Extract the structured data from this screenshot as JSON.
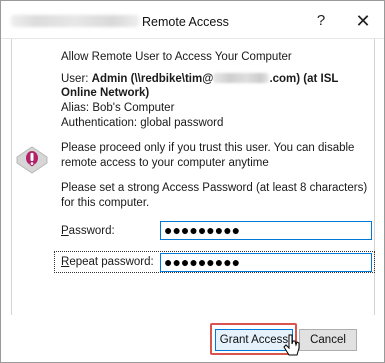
{
  "window": {
    "title": "Remote Access",
    "help_label": "?",
    "close_label": "✕"
  },
  "content": {
    "prompt": "Allow Remote User to Access Your Computer",
    "user_prefix": "User: ",
    "user_name_part1": "Admin (\\\\redbike\\tim@",
    "user_name_part2": ".com) (at ISL",
    "user_name_line2": "Online Network)",
    "alias": "Alias: Bob's Computer",
    "authentication": "Authentication: global password",
    "trust_message": "Please proceed only if you trust this user. You can disable remote access to your computer anytime",
    "password_instruction": "Please set a strong Access Password (at least 8 characters) for this computer.",
    "warning_icon": "warning-exclamation-icon"
  },
  "form": {
    "password_label_underlined": "P",
    "password_label_rest": "assword:",
    "password_value": "●●●●●●●●●",
    "repeat_label_underlined": "R",
    "repeat_label_rest": "epeat password:",
    "repeat_value": "●●●●●●●●●"
  },
  "buttons": {
    "grant": "Grant Access",
    "cancel": "Cancel"
  },
  "colors": {
    "focus_border": "#0078d7",
    "highlight_outline": "#d9534f",
    "warning_icon": "#b2226a"
  }
}
